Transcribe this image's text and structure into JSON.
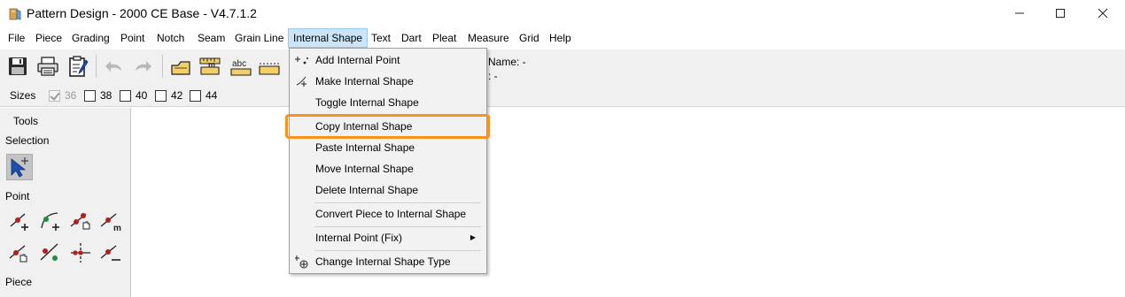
{
  "window": {
    "title": "Pattern Design - 2000 CE Base - V4.7.1.2",
    "minimize_glyph": "—",
    "maximize_glyph": "☐",
    "close_glyph": "✕"
  },
  "menubar": {
    "items": [
      "File",
      "Piece",
      "Grading",
      "Point",
      "Notch",
      "Seam",
      "Grain Line",
      "Internal Shape",
      "Text",
      "Dart",
      "Pleat",
      "Measure",
      "Grid",
      "Help"
    ],
    "active": "Internal Shape"
  },
  "toolbar": {
    "icons": [
      "save-icon",
      "print-icon",
      "properties-icon",
      "undo-icon",
      "redo-icon",
      "piece-icon",
      "measure-tape-icon",
      "text-abc-icon",
      "seam-icon"
    ],
    "text_icon_label": "abc",
    "measure_icon_label": "m",
    "props_name": "Name: -",
    "props_second": ": -"
  },
  "sizes": {
    "label": "Sizes",
    "items": [
      {
        "label": "36",
        "checked": true,
        "disabled": true
      },
      {
        "label": "38",
        "checked": false,
        "disabled": false
      },
      {
        "label": "40",
        "checked": false,
        "disabled": false
      },
      {
        "label": "42",
        "checked": false,
        "disabled": false
      },
      {
        "label": "44",
        "checked": false,
        "disabled": false
      }
    ]
  },
  "tools_panel": {
    "title": "Tools",
    "groups": {
      "selection": "Selection",
      "point": "Point",
      "piece": "Piece"
    },
    "point_tool_labels": {
      "m": "m"
    }
  },
  "internal_shape_menu": {
    "items": [
      {
        "label": "Add Internal Point",
        "icon": "add-internal-point-icon"
      },
      {
        "label": "Make Internal Shape",
        "icon": "make-internal-shape-icon"
      },
      {
        "label": "Toggle Internal Shape",
        "icon": ""
      },
      {
        "label": "Copy Internal Shape",
        "icon": "",
        "highlighted": true
      },
      {
        "label": "Paste Internal Shape",
        "icon": ""
      },
      {
        "label": "Move Internal Shape",
        "icon": ""
      },
      {
        "label": "Delete Internal Shape",
        "icon": ""
      },
      {
        "label": "Convert Piece to Internal Shape",
        "icon": ""
      },
      {
        "label": "Internal Point (Fix)",
        "icon": "",
        "submenu": true
      },
      {
        "label": "Change Internal Shape Type",
        "icon": "change-type-icon"
      }
    ],
    "submenu_arrow": "▶"
  },
  "colors": {
    "highlight": "#f7931e",
    "point_red": "#b02020",
    "point_green": "#1e8f3a",
    "tool_blue": "#1c4fb0"
  }
}
